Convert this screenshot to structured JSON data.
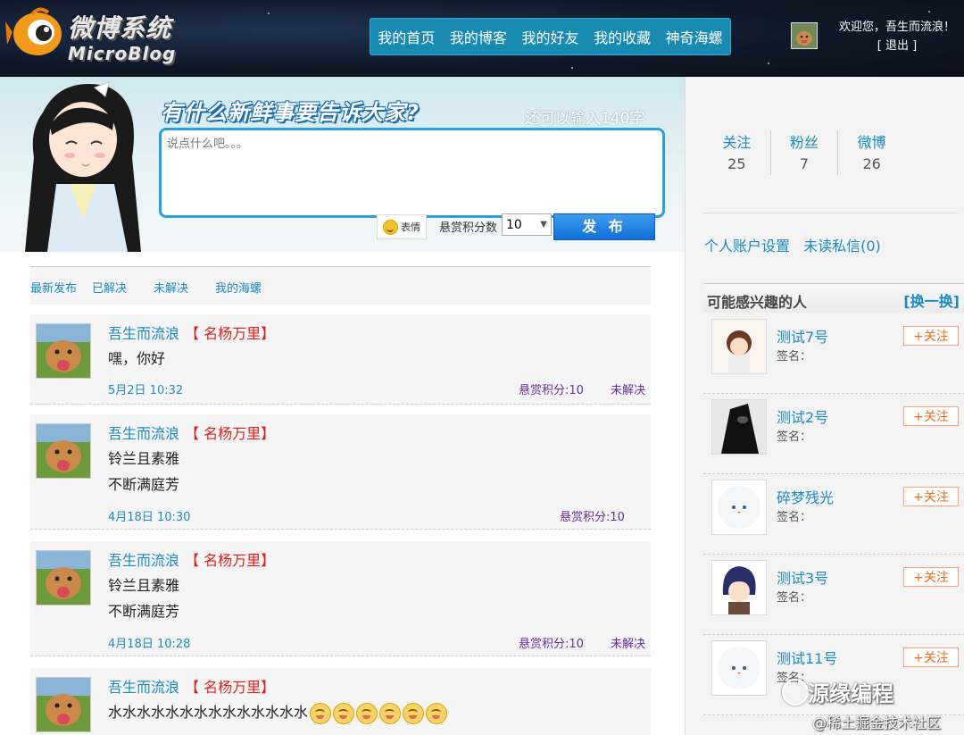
{
  "header": {
    "logo_cn": "微博系统",
    "logo_en": "MicroBlog",
    "nav": [
      "我的首页",
      "我的博客",
      "我的好友",
      "我的收藏",
      "神奇海螺"
    ],
    "welcome": "欢迎您，吾生而流浪！",
    "logout": "[ 退出 ]"
  },
  "composer": {
    "title": "有什么新鲜事要告诉大家?",
    "remaining": "还可以输入140字",
    "placeholder": "说点什么吧。。。",
    "emoji_label": "表情",
    "reward_label": "悬赏积分数",
    "reward_value": "10",
    "publish": "发 布"
  },
  "tabs": [
    "最新发布",
    "已解决",
    "未解决",
    "我的海螺"
  ],
  "posts": [
    {
      "author": "吾生而流浪",
      "tag": "【 名杨万里】",
      "lines": [
        "嘿，你好"
      ],
      "time": "5月2日 10:32",
      "reward": "悬赏积分:10",
      "status": "未解决"
    },
    {
      "author": "吾生而流浪",
      "tag": "【 名杨万里】",
      "lines": [
        "铃兰且素雅",
        "不断满庭芳"
      ],
      "time": "4月18日 10:30",
      "reward": "悬赏积分:10",
      "status": ""
    },
    {
      "author": "吾生而流浪",
      "tag": "【 名杨万里】",
      "lines": [
        "铃兰且素雅",
        "不断满庭芳"
      ],
      "time": "4月18日 10:28",
      "reward": "悬赏积分:10",
      "status": "未解决"
    },
    {
      "author": "吾生而流浪",
      "tag": "【 名杨万里】",
      "lines": [
        "水水水水水水水水水水水水水水"
      ],
      "time": "",
      "reward": "",
      "status": ""
    }
  ],
  "sidebar": {
    "stats": [
      {
        "label": "关注",
        "value": "25"
      },
      {
        "label": "粉丝",
        "value": "7"
      },
      {
        "label": "微博",
        "value": "26"
      }
    ],
    "links": [
      "个人账户设置",
      "未读私信(0)"
    ],
    "interest_title": "可能感兴趣的人",
    "refresh": "[换一换]",
    "people": [
      {
        "name": "测试7号",
        "sig": "签名：",
        "follow": "+关注"
      },
      {
        "name": "测试2号",
        "sig": "签名：",
        "follow": "+关注"
      },
      {
        "name": "碎梦残光",
        "sig": "签名：",
        "follow": "+关注"
      },
      {
        "name": "测试3号",
        "sig": "签名：",
        "follow": "+关注"
      },
      {
        "name": "测试11号",
        "sig": "签名：",
        "follow": "+关注"
      }
    ]
  },
  "watermark": {
    "line1": "源缘编程",
    "line2": "@稀土掘金技术社区"
  },
  "colors": {
    "link": "#1a8bc4",
    "nav_bg": "#1a8bb0",
    "tag": "#e02020",
    "reward": "#6a2c9a",
    "follow": "#ea6a1c",
    "publish": "#0f6fd6"
  }
}
